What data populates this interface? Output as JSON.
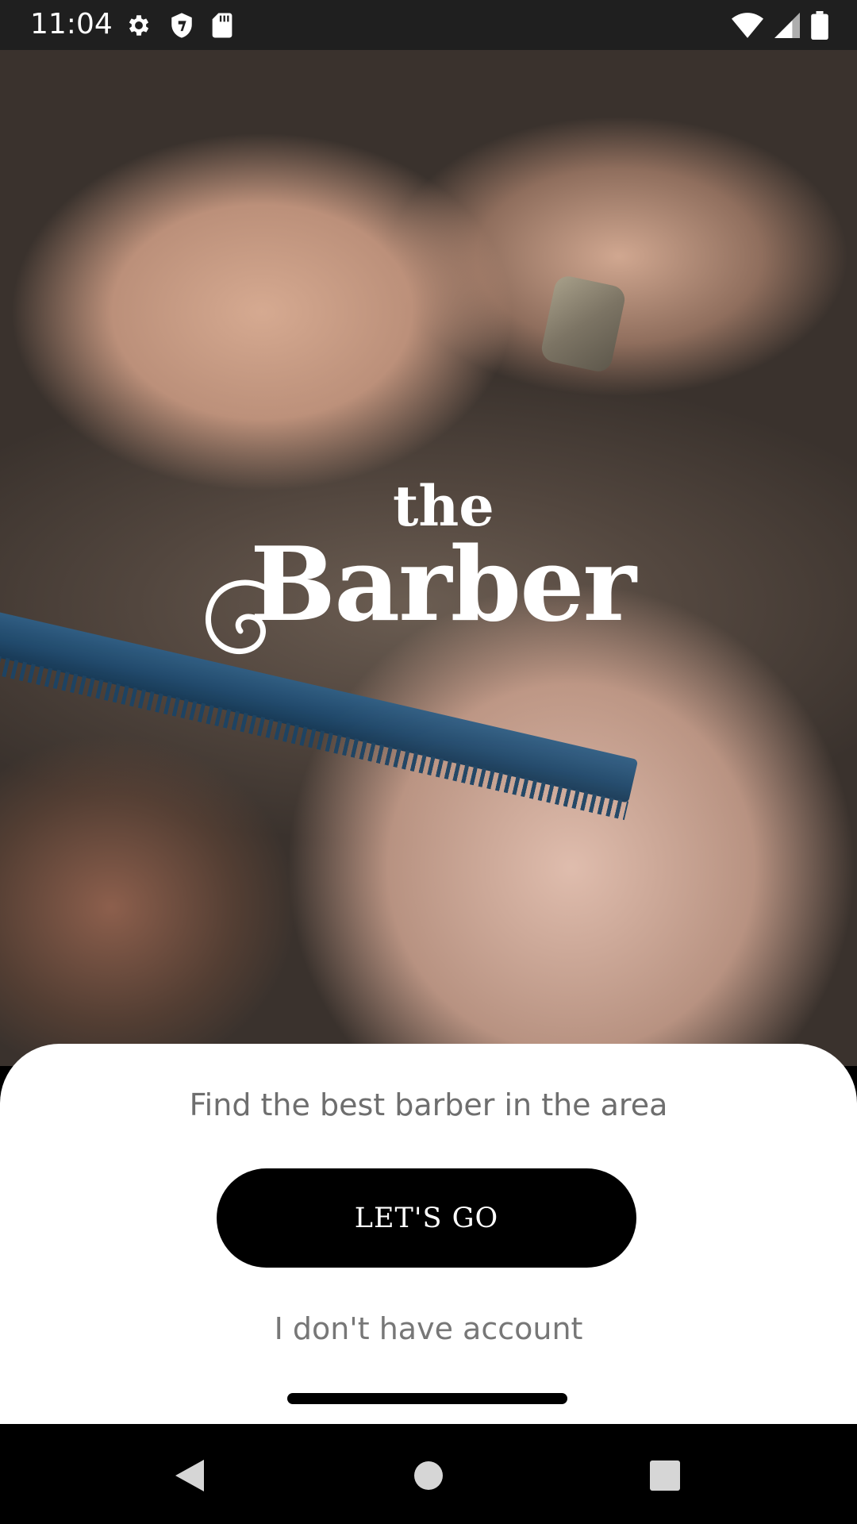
{
  "status_bar": {
    "time": "11:04",
    "left_icons": [
      "gear-icon",
      "shield-icon",
      "sd-card-icon"
    ],
    "right_icons": [
      "wifi-icon",
      "cell-signal-icon",
      "battery-icon"
    ]
  },
  "logo": {
    "line1": "the",
    "line2": "Barber"
  },
  "onboarding": {
    "tagline": "Find the best barber in the area",
    "primary_button": "LET'S GO",
    "secondary_link": "I don't have account"
  },
  "nav_bar": {
    "buttons": [
      "back-icon",
      "home-icon",
      "recents-icon"
    ]
  },
  "colors": {
    "status_bar_bg": "#1f1f1f",
    "sheet_bg": "#ffffff",
    "button_bg": "#000000",
    "button_text": "#ffffff",
    "tagline_text": "#6e6e6e",
    "nav_bar_bg": "#000000"
  }
}
